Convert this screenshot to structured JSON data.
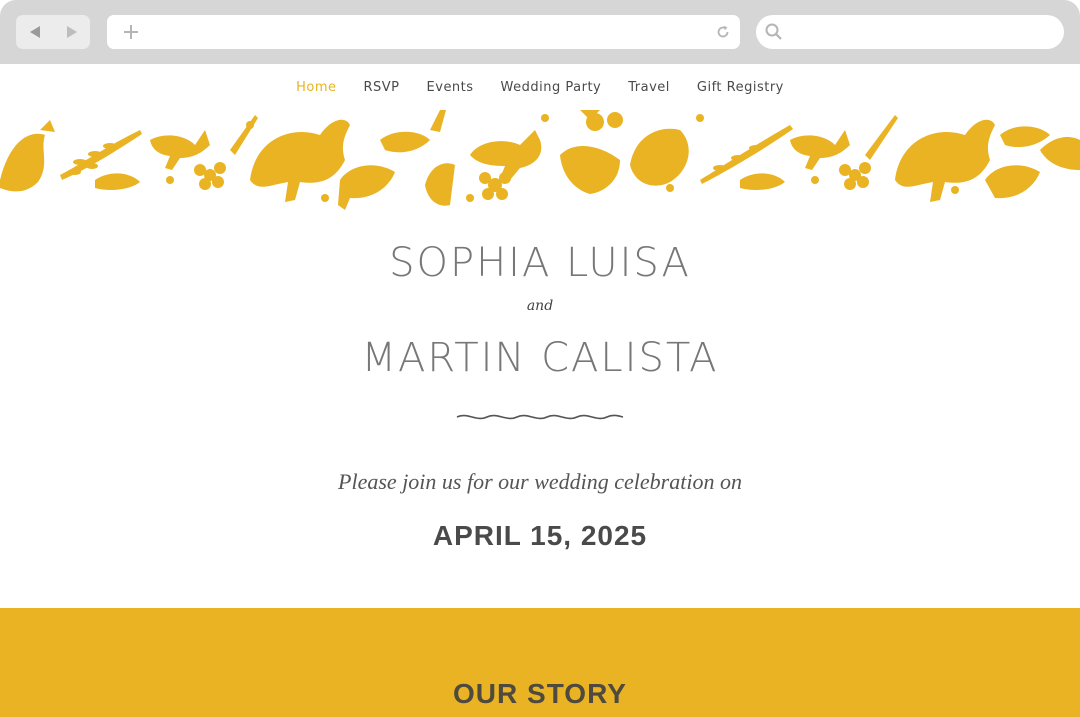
{
  "colors": {
    "accent": "#e9b323",
    "chrome": "#d6d6d6",
    "text_dark": "#4a4a4a"
  },
  "browser": {
    "back_icon": "back-arrow-icon",
    "forward_icon": "forward-arrow-icon",
    "new_tab_icon": "plus-icon",
    "reload_icon": "reload-icon",
    "search_icon": "search-icon",
    "url_value": "",
    "search_value": ""
  },
  "nav": {
    "items": [
      {
        "label": "Home",
        "active": true
      },
      {
        "label": "RSVP",
        "active": false
      },
      {
        "label": "Events",
        "active": false
      },
      {
        "label": "Wedding Party",
        "active": false
      },
      {
        "label": "Travel",
        "active": false
      },
      {
        "label": "Gift Registry",
        "active": false
      }
    ]
  },
  "hero": {
    "name_one": "SOPHIA LUISA",
    "and_text": "and",
    "name_two": "MARTIN CALISTA",
    "invite_text": "Please join us for our wedding celebration on",
    "date": "APRIL 15, 2025"
  },
  "story": {
    "title": "OUR STORY"
  }
}
